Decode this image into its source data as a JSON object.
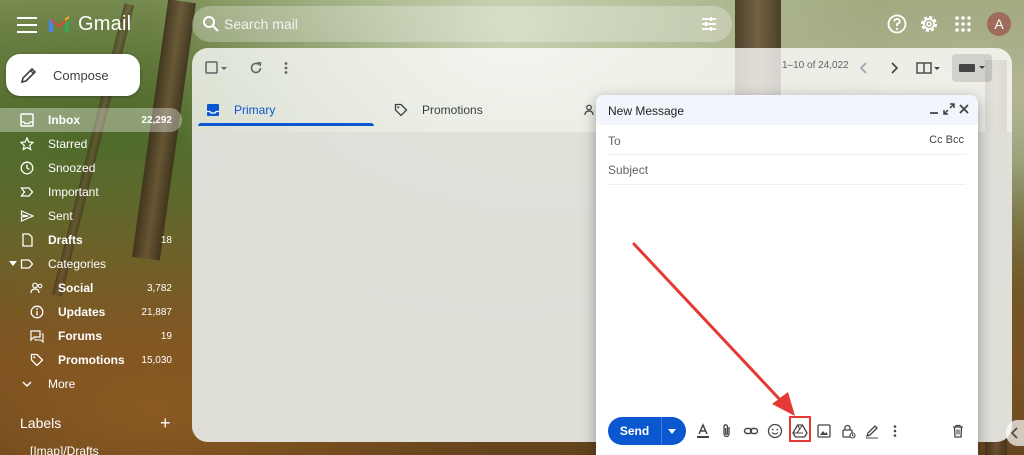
{
  "app": {
    "logo_text": "Gmail",
    "brand_colors": {
      "red": "#ea4335",
      "blue": "#4285f4",
      "green": "#34a853",
      "yellow": "#fbbc04"
    }
  },
  "search": {
    "placeholder": "Search mail",
    "icon": "search-icon",
    "filter_icon": "search-options-icon"
  },
  "topbar": {
    "icons": [
      "support-icon",
      "settings-icon",
      "apps-grid-icon"
    ],
    "avatar_letter": "A"
  },
  "compose": {
    "label": "Compose",
    "icon": "pencil-icon"
  },
  "sidebar": {
    "items": [
      {
        "label": "Inbox",
        "count": "22,292",
        "icon": "inbox-icon"
      },
      {
        "label": "Starred",
        "count": "",
        "icon": "star-icon"
      },
      {
        "label": "Snoozed",
        "count": "",
        "icon": "clock-icon"
      },
      {
        "label": "Important",
        "count": "",
        "icon": "important-icon"
      },
      {
        "label": "Sent",
        "count": "",
        "icon": "send-icon"
      },
      {
        "label": "Drafts",
        "count": "18",
        "icon": "draft-icon"
      },
      {
        "label": "Categories",
        "count": "",
        "icon": "label-icon"
      },
      {
        "label": "Social",
        "count": "3,782",
        "icon": "people-icon"
      },
      {
        "label": "Updates",
        "count": "21,887",
        "icon": "info-icon"
      },
      {
        "label": "Forums",
        "count": "19",
        "icon": "forum-icon"
      },
      {
        "label": "Promotions",
        "count": "15,030",
        "icon": "tag-icon"
      },
      {
        "label": "More",
        "count": "",
        "icon": "chevron-down-icon"
      }
    ],
    "labels_heading": "Labels",
    "labels_add": "+",
    "label_items": [
      "[Imap]/Drafts"
    ]
  },
  "toolbar": {
    "pagination": "1–10 of 24,022"
  },
  "tabs": [
    {
      "label": "Primary",
      "icon": "inbox-icon",
      "active": true
    },
    {
      "label": "Promotions",
      "icon": "tag-icon",
      "active": false
    }
  ],
  "compose_window": {
    "title": "New Message",
    "to_label": "To",
    "cc_bcc": "Cc Bcc",
    "subject_placeholder": "Subject",
    "send_label": "Send",
    "highlighted_tool": "google-drive-icon",
    "highlight_color": "#e53935"
  }
}
